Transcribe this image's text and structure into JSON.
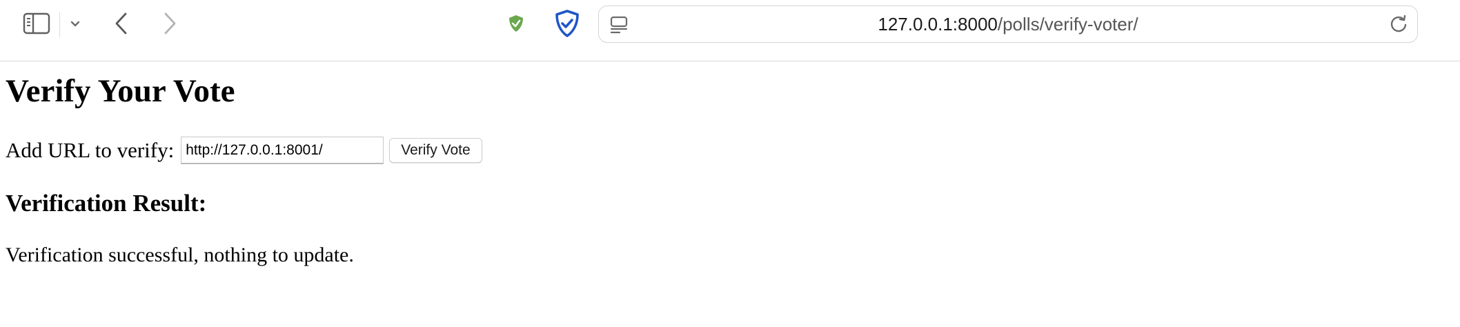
{
  "browser": {
    "address_bar": {
      "url_host": "127.0.0.1:8000",
      "url_path": "/polls/verify-voter/"
    },
    "icons": {
      "sidebar": "sidebar-icon",
      "tab_overview_chevron": "chevron-down-icon",
      "back": "chevron-left-icon",
      "forward": "chevron-right-icon",
      "privacy_shield": "shield-check-icon",
      "extension_shield": "shield-check-icon",
      "page_menu": "page-menu-icon",
      "reload": "reload-icon"
    },
    "colors": {
      "shield_green": "#6aa84f",
      "shield_blue": "#1f56c8"
    }
  },
  "page": {
    "title": "Verify Your Vote",
    "form": {
      "label": "Add URL to verify:",
      "input_value": "http://127.0.0.1:8001/",
      "submit_label": "Verify Vote"
    },
    "result": {
      "heading": "Verification Result:",
      "message": "Verification successful, nothing to update."
    }
  }
}
